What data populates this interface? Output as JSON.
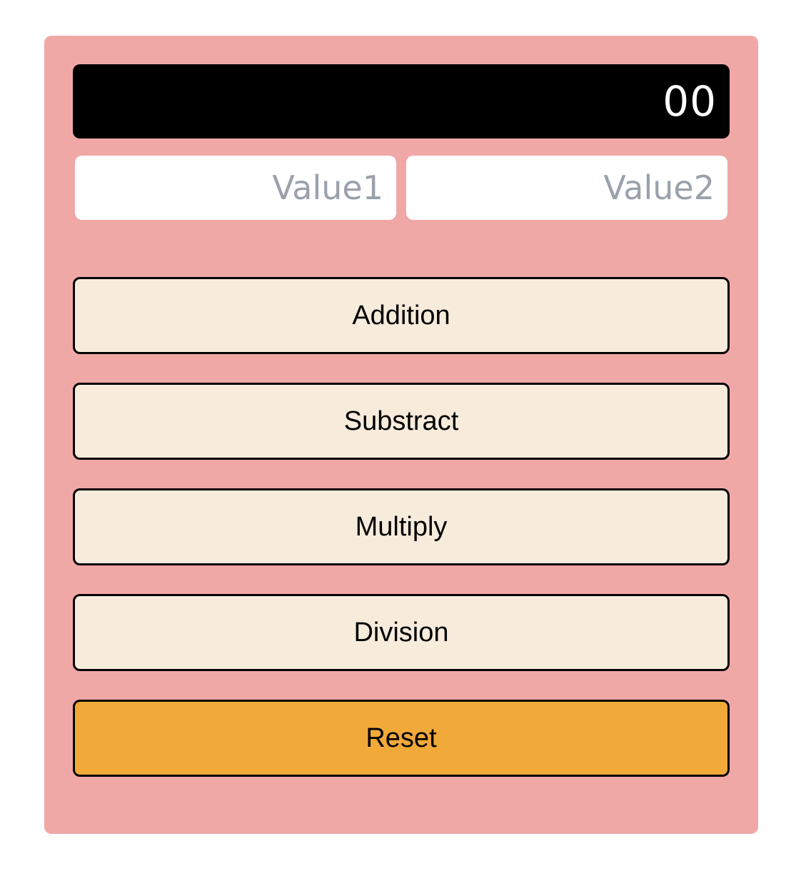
{
  "colors": {
    "panel_bg": "#f0a8a7",
    "display_bg": "#000000",
    "display_text": "#ffffff",
    "op_button_bg": "#f7ebdb",
    "reset_button_bg": "#f1a93a",
    "placeholder": "#9aa1ab"
  },
  "display": {
    "value": "00"
  },
  "inputs": {
    "value1_placeholder": "Value1",
    "value2_placeholder": "Value2"
  },
  "buttons": {
    "addition": "Addition",
    "subtract": "Substract",
    "multiply": "Multiply",
    "division": "Division",
    "reset": "Reset"
  }
}
